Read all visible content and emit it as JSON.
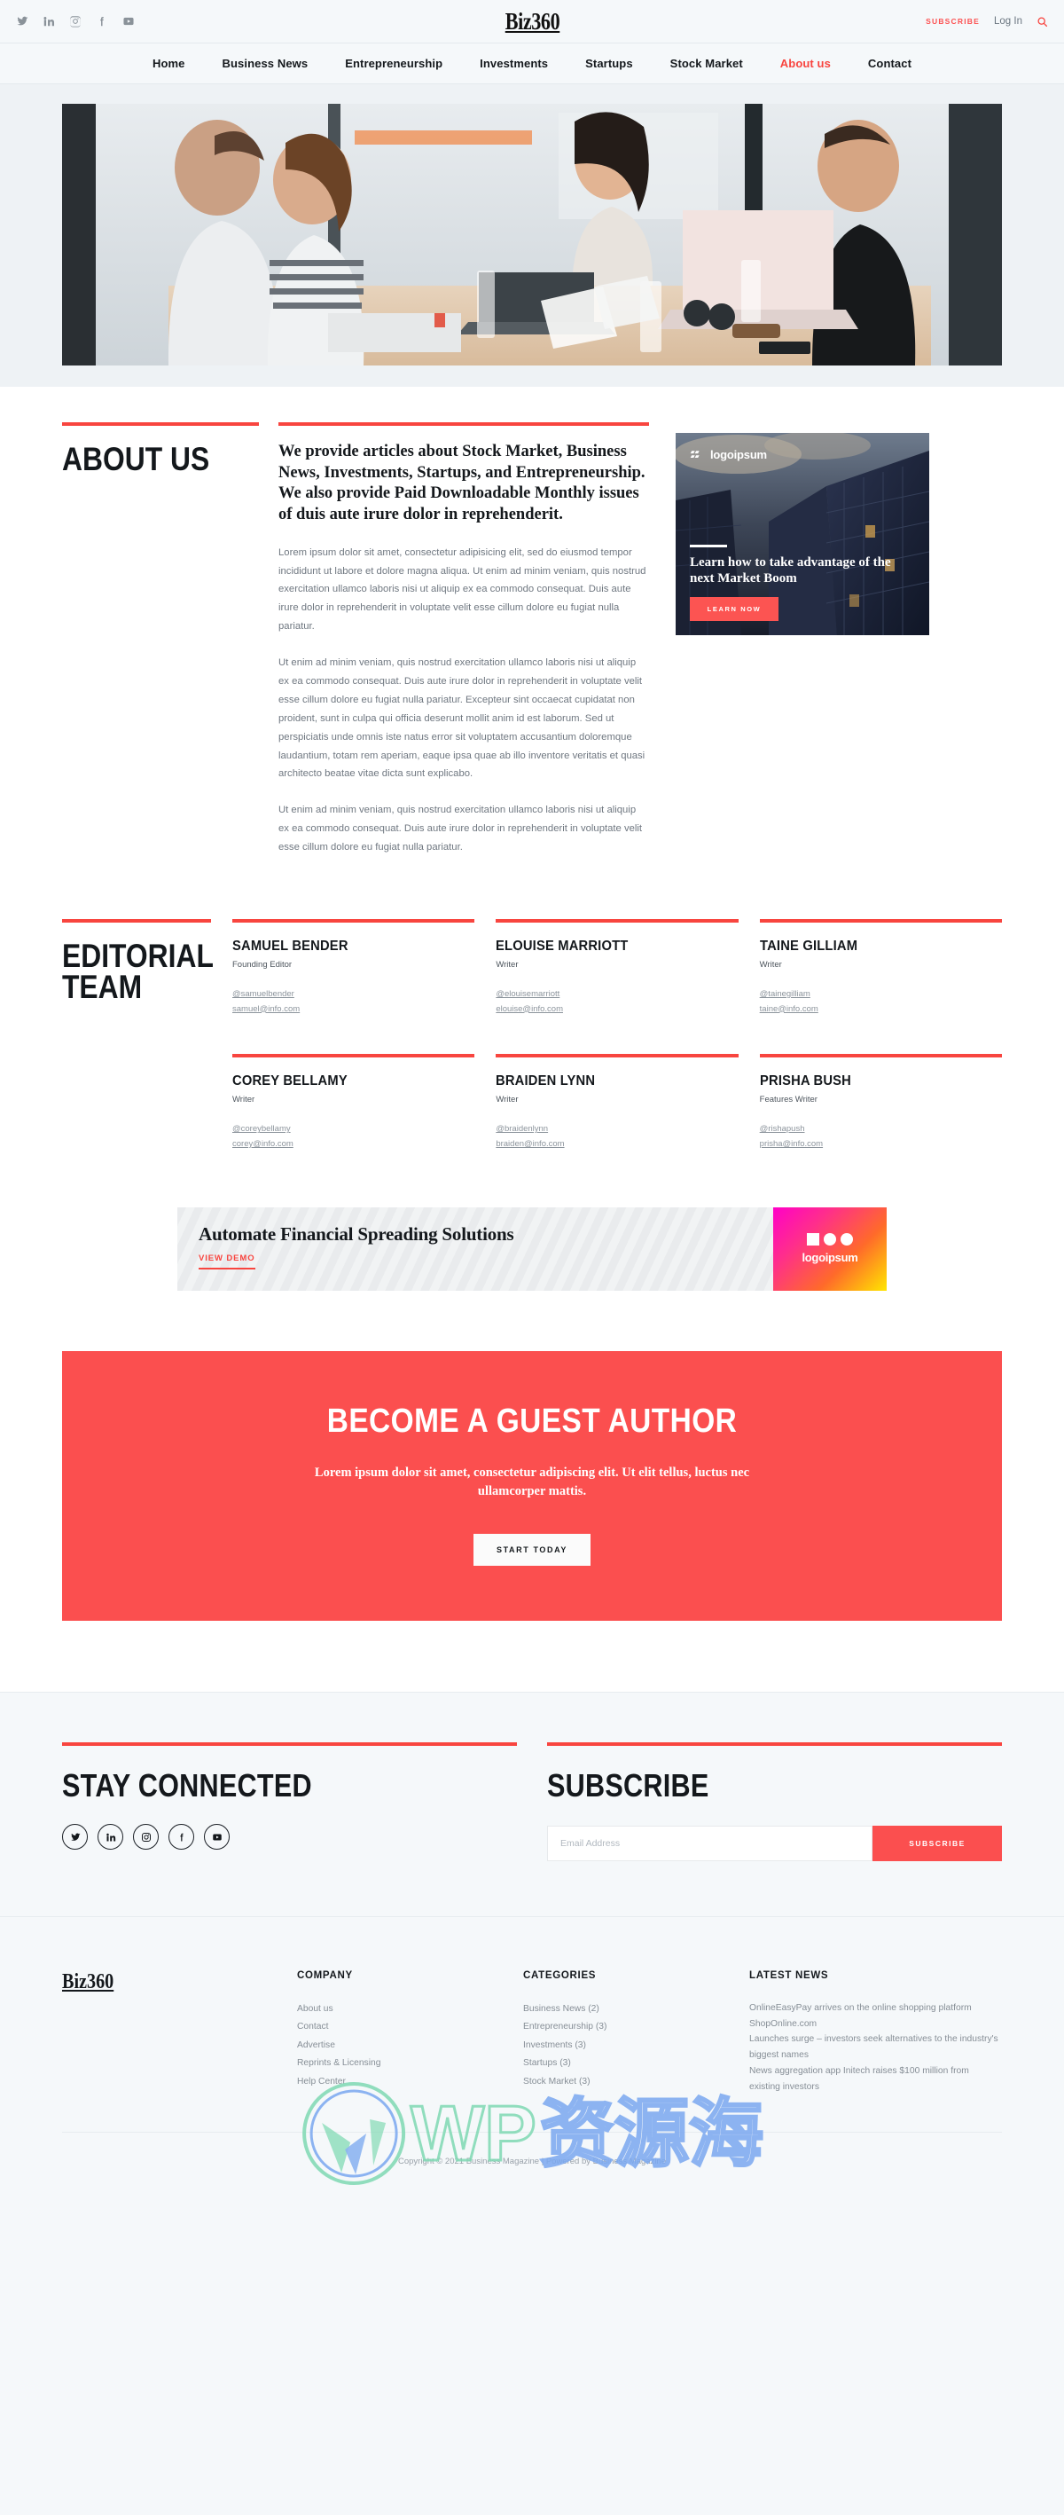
{
  "header": {
    "brand": "Biz360",
    "social": [
      {
        "name": "twitter-icon",
        "label": "Twitter"
      },
      {
        "name": "linkedin-icon",
        "label": "LinkedIn"
      },
      {
        "name": "instagram-icon",
        "label": "Instagram"
      },
      {
        "name": "facebook-icon",
        "label": "Facebook"
      },
      {
        "name": "youtube-icon",
        "label": "YouTube"
      }
    ],
    "subscribe_label": "SUBSCRIBE",
    "login_label": "Log In",
    "search_icon": "search-icon"
  },
  "nav": {
    "items": [
      {
        "label": "Home",
        "active": false
      },
      {
        "label": "Business News",
        "active": false
      },
      {
        "label": "Entrepreneurship",
        "active": false
      },
      {
        "label": "Investments",
        "active": false
      },
      {
        "label": "Startups",
        "active": false
      },
      {
        "label": "Stock Market",
        "active": false
      },
      {
        "label": "About us",
        "active": true
      },
      {
        "label": "Contact",
        "active": false
      }
    ]
  },
  "about": {
    "title": "About Us",
    "lede": "We provide articles about Stock Market, Business News, Investments, Startups, and Entrepreneurship. We also provide Paid Downloadable Monthly issues of duis aute irure dolor in reprehenderit.",
    "p1": "Lorem ipsum dolor sit amet, consectetur adipisicing elit, sed do eiusmod tempor incididunt ut labore et dolore magna aliqua. Ut enim ad minim veniam, quis nostrud exercitation ullamco laboris nisi ut aliquip ex ea commodo consequat. Duis aute irure dolor in reprehenderit in voluptate velit esse cillum dolore eu fugiat nulla pariatur.",
    "p2": "Ut enim ad minim veniam, quis nostrud exercitation ullamco laboris nisi ut aliquip ex ea commodo consequat. Duis aute irure dolor in reprehenderit in voluptate velit esse cillum dolore eu fugiat nulla pariatur. Excepteur sint occaecat cupidatat non proident, sunt in culpa qui officia deserunt mollit anim id est laborum. Sed ut perspiciatis unde omnis iste natus error sit voluptatem accusantium doloremque laudantium, totam rem aperiam, eaque ipsa quae ab illo inventore veritatis et quasi architecto beatae vitae dicta sunt explicabo.",
    "p3": "Ut enim ad minim veniam, quis nostrud exercitation ullamco laboris nisi ut aliquip ex ea commodo consequat. Duis aute irure dolor in reprehenderit in voluptate velit esse cillum dolore eu fugiat nulla pariatur."
  },
  "widget_ad": {
    "logo_text": "logoipsum",
    "headline": "Learn how to take advantage of the next Market Boom",
    "button_label": "LEARN NOW"
  },
  "team": {
    "title_line1": "Editorial",
    "title_line2": "Team",
    "members": [
      {
        "name": "SAMUEL BENDER",
        "role": "Founding Editor",
        "handle": "@samuelbender",
        "email": "samuel@info.com"
      },
      {
        "name": "ELOUISE MARRIOTT",
        "role": "Writer",
        "handle": "@elouisemarriott",
        "email": "elouise@info.com"
      },
      {
        "name": "TAINE GILLIAM",
        "role": "Writer",
        "handle": "@tainegilliam",
        "email": "taine@info.com"
      },
      {
        "name": "COREY BELLAMY",
        "role": "Writer",
        "handle": "@coreybellamy",
        "email": "corey@info.com"
      },
      {
        "name": "BRAIDEN LYNN",
        "role": "Writer",
        "handle": "@braidenlynn",
        "email": "braiden@info.com"
      },
      {
        "name": "PRISHA BUSH",
        "role": "Features Writer",
        "handle": "@rishapush",
        "email": "prisha@info.com"
      }
    ]
  },
  "banner_ad": {
    "headline": "Automate Financial Spreading Solutions",
    "cta_label": "VIEW DEMO",
    "logo_text": "logoipsum"
  },
  "cta": {
    "heading": "Become a Guest Author",
    "paragraph": "Lorem ipsum dolor sit amet, consectetur adipiscing elit. Ut elit tellus, luctus nec ullamcorper mattis.",
    "button_label": "START TODAY"
  },
  "connect": {
    "title": "Stay Connected",
    "socials": [
      {
        "name": "twitter-icon",
        "label": "Twitter"
      },
      {
        "name": "linkedin-icon",
        "label": "LinkedIn"
      },
      {
        "name": "instagram-icon",
        "label": "Instagram"
      },
      {
        "name": "facebook-icon",
        "label": "Facebook"
      },
      {
        "name": "youtube-icon",
        "label": "YouTube"
      }
    ]
  },
  "subscribe": {
    "title": "Subscribe",
    "placeholder": "Email Address",
    "value": "",
    "button_label": "SUBSCRIBE"
  },
  "footer": {
    "logo": "Biz360",
    "company": {
      "heading": "COMPANY",
      "links": [
        "About us",
        "Contact",
        "Advertise",
        "Reprints & Licensing",
        "Help Center"
      ]
    },
    "categories": {
      "heading": "CATEGORIES",
      "links": [
        "Business News (2)",
        "Entrepreneurship (3)",
        "Investments (3)",
        "Startups (3)",
        "Stock Market (3)"
      ]
    },
    "latest_news": {
      "heading": "LATEST NEWS",
      "items": [
        "OnlineEasyPay arrives on the online shopping platform ShopOnline.com",
        "Launches surge – investors seek alternatives to the industry's biggest names",
        "News aggregation app Initech raises $100 million from existing investors"
      ]
    },
    "copyright": "Copyright © 2021 Business Magazine | Powered by Business Magazine"
  },
  "watermark": {
    "text_en": "WP",
    "text_cn": "资源海"
  },
  "colors": {
    "accent": "#f8453f",
    "cta_bg": "#fb4f4f",
    "page_bg": "#f5f8fa",
    "text": "#14181c",
    "muted": "#868e96"
  }
}
